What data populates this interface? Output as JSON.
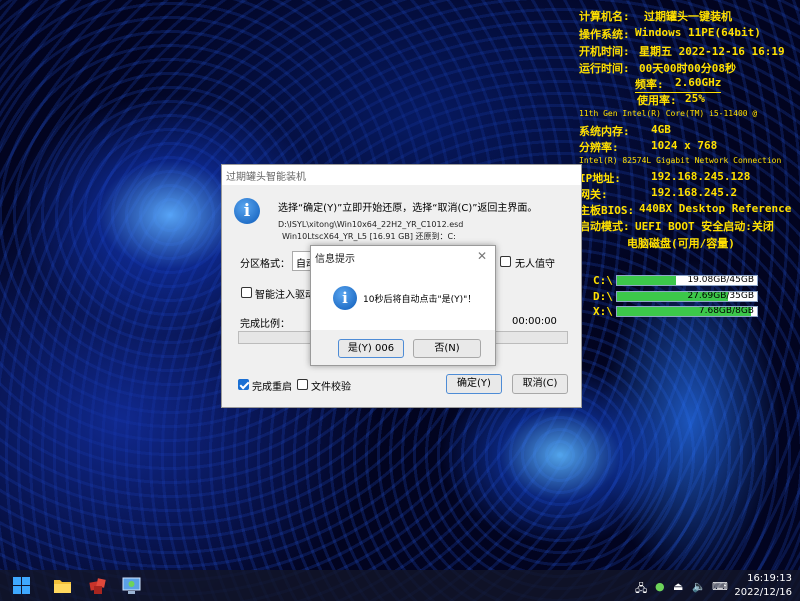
{
  "sysinfo": {
    "computer_name_label": "计算机名:",
    "computer_name": "过期罐头一键装机",
    "os_label": "操作系统:",
    "os": "Windows 11PE(64bit)",
    "boot_time_label": "开机时间:",
    "boot_time": "星期五 2022-12-16 16:19",
    "uptime_label": "运行时间:",
    "uptime": "00天00时00分08秒",
    "freq_label": "频率:",
    "freq": "2.60GHz",
    "usage_label": "使用率:",
    "usage": "25%",
    "cpu": "11th Gen Intel(R) Core(TM) i5-11400 @",
    "memory_label": "系统内存:",
    "memory": "4GB",
    "resolution_label": "分辨率:",
    "resolution": "1024 x 768",
    "nic": "Intel(R) 82574L Gigabit Network Connection",
    "ip_label": "IP地址:",
    "ip": "192.168.245.128",
    "gateway_label": "网关:",
    "gateway": "192.168.245.2",
    "bios_label": "主板BIOS:",
    "bios": "440BX Desktop Reference",
    "boot_mode_label": "启动模式:",
    "boot_mode": "UEFI BOOT 安全启动:关闭",
    "disk_header": "电脑磁盘(可用/容量)",
    "disks": [
      {
        "label": "C:\\",
        "text": "19.08GB/45GB",
        "fill_fraction": 0.42
      },
      {
        "label": "D:\\",
        "text": "27.69GB/35GB",
        "fill_fraction": 0.79
      },
      {
        "label": "X:\\",
        "text": "7.68GB/8GB",
        "fill_fraction": 0.96
      }
    ]
  },
  "main_dialog": {
    "title": "过期罐头智能装机",
    "prompt": "选择“确定(Y)”立即开始还原，选择“取消(C)”返回主界面。",
    "image_path": "D:\\ISYL\\xitong\\Win10x64_22H2_YR_C1012.esd",
    "image_info": "Win10LtscX64_YR_L5 [16.91 GB]  还原到：C:",
    "partition_label": "分区格式：",
    "partition_value": "自动",
    "unattended_label": "无人值守",
    "driver_inject_label": "智能注入驱动",
    "progress_label": "完成比例：",
    "elapsed": "00:00:00",
    "progress_fraction": 0,
    "reboot_label": "完成重启",
    "verify_label": "文件校验",
    "ok_button": "确定(Y)",
    "cancel_button": "取消(C)"
  },
  "msg_box": {
    "title": "信息提示",
    "message": "10秒后将自动点击\"是(Y)\"！",
    "yes_button": "是(Y) 006",
    "no_button": "否(N)"
  },
  "taskbar": {
    "time": "16:19:13",
    "date": "2022/12/16"
  },
  "colors": {
    "sysinfo_text": "#ffe000",
    "disk_fill": "#3cc84a",
    "checkbox_accent": "#1a6fd3"
  }
}
